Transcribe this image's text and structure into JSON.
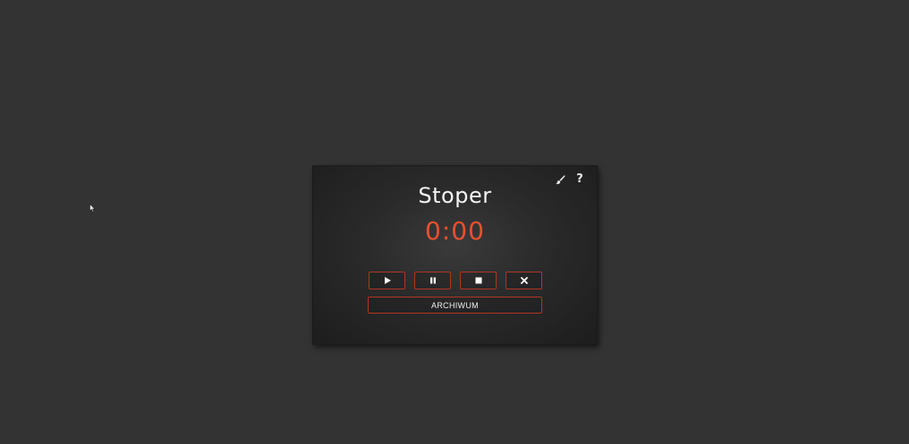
{
  "app": {
    "title": "Stoper",
    "time_display": "0:00",
    "accent_color": "#e8502f",
    "background_color": "#333333"
  },
  "toolbar": {
    "theme_icon": "brush-icon",
    "help_icon": "question-icon",
    "help_label": "?"
  },
  "controls": [
    {
      "name": "start",
      "icon": "play-icon"
    },
    {
      "name": "pause",
      "icon": "pause-icon"
    },
    {
      "name": "stop",
      "icon": "stop-icon"
    },
    {
      "name": "reset",
      "icon": "close-icon"
    }
  ],
  "archive": {
    "label": "ARCHIWUM"
  }
}
